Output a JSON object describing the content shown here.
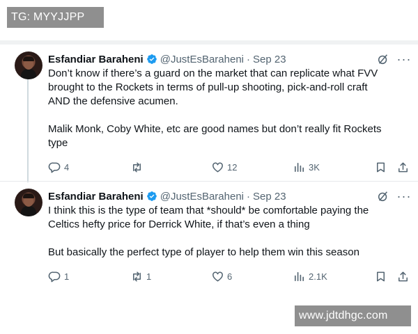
{
  "watermarks": {
    "top": "TG: MYYJJPP",
    "bottom": "www.jdtdhgc.com"
  },
  "tweets": [
    {
      "author": "Esfandiar Baraheni",
      "handle": "@JustEsBaraheni",
      "separator": "·",
      "date": "Sep 23",
      "lines": [
        "Don’t know if there’s a guard on the market that can replicate what FVV",
        "brought to the Rockets in terms of pull-up shooting, pick-and-roll craft",
        "AND the defensive acumen.",
        "",
        "Malik Monk, Coby White, etc are good names but don’t really fit Rockets",
        "type"
      ],
      "replies": "4",
      "retweets": "",
      "likes": "12",
      "views": "3K"
    },
    {
      "author": "Esfandiar Baraheni",
      "handle": "@JustEsBaraheni",
      "separator": "·",
      "date": "Sep 23",
      "lines": [
        "I think this is the type of team that *should* be comfortable paying the",
        "Celtics hefty price for Derrick White, if that’s even a thing",
        "",
        "But basically the perfect type of player to help them win this season"
      ],
      "replies": "1",
      "retweets": "1",
      "likes": "6",
      "views": "2.1K"
    }
  ],
  "colors": {
    "verified": "#1d9bf0",
    "muted": "#536471",
    "text": "#0f1419",
    "thread_line": "#cfd9de"
  },
  "icons": [
    "verified-badge-icon",
    "grok-icon",
    "more-icon",
    "reply-icon",
    "retweet-icon",
    "like-icon",
    "views-icon",
    "bookmark-icon",
    "share-icon"
  ],
  "more_glyph": "···"
}
